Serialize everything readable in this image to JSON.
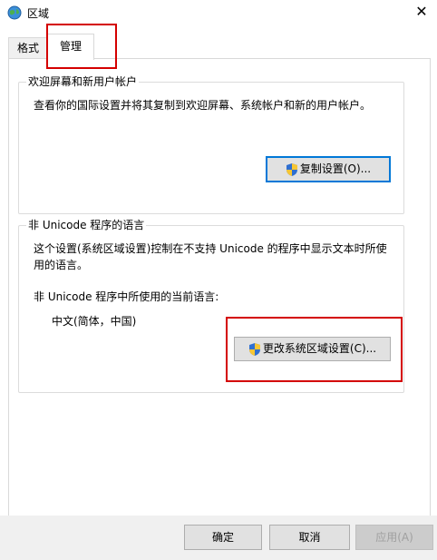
{
  "window": {
    "title": "区域",
    "icon": "globe-icon",
    "close_glyph": "✕"
  },
  "tabs": [
    {
      "label": "格式",
      "selected": false
    },
    {
      "label": "管理",
      "selected": true
    }
  ],
  "welcome_group": {
    "title": "欢迎屏幕和新用户帐户",
    "description": "查看你的国际设置并将其复制到欢迎屏幕、系统帐户和新的用户帐户。",
    "copy_button": "复制设置(O)..."
  },
  "unicode_group": {
    "title": "非 Unicode 程序的语言",
    "description_line1": "这个设置(系统区域设置)控制在不支持 Unicode 的程序中显示文本时所使",
    "description_line2": "用的语言。",
    "current_label": "非 Unicode 程序中所使用的当前语言:",
    "current_value": "中文(简体，中国)",
    "change_button": "更改系统区域设置(C)..."
  },
  "footer": {
    "ok": "确定",
    "cancel": "取消",
    "apply": "应用(A)"
  },
  "colors": {
    "highlight": "#d40000",
    "focus": "#0078d7",
    "button_bg": "#e1e1e1",
    "footer_bg": "#f0f0f0"
  }
}
